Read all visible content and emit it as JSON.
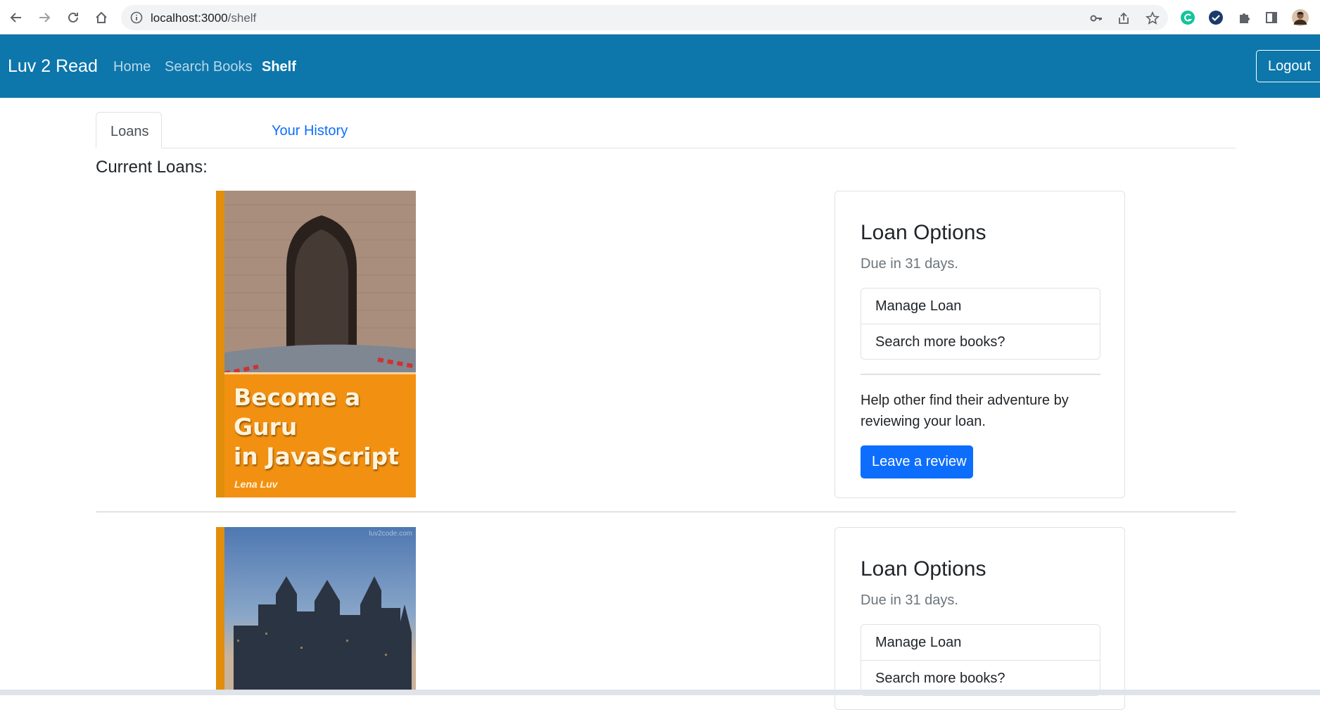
{
  "browser": {
    "url_host": "localhost:3000",
    "url_path": "/shelf",
    "icons": [
      "back-arrow-icon",
      "forward-arrow-icon",
      "reload-icon",
      "home-icon",
      "info-icon",
      "key-icon",
      "share-icon",
      "star-icon",
      "grammarly-icon",
      "check-extension-icon",
      "puzzle-icon",
      "sidepanel-icon",
      "profile-avatar"
    ]
  },
  "navbar": {
    "brand": "Luv 2 Read",
    "links": [
      {
        "label": "Home",
        "active": false
      },
      {
        "label": "Search Books",
        "active": false
      },
      {
        "label": "Shelf",
        "active": true
      }
    ],
    "logout": "Logout",
    "color": "#0d76ab"
  },
  "tabs": [
    {
      "label": "Loans",
      "active": true
    },
    {
      "label": "Your History",
      "active": false
    }
  ],
  "section_title": "Current Loans:",
  "loans": [
    {
      "cover": {
        "title_line1": "Become a Guru",
        "title_line2": "in JavaScript",
        "author": "Lena Luv",
        "color": "#f29111"
      },
      "options": {
        "title": "Loan Options",
        "due": "Due in 31 days.",
        "actions": [
          "Manage Loan",
          "Search more books?"
        ],
        "help": "Help other find their adventure by reviewing your loan.",
        "review_button": "Leave a review"
      }
    },
    {
      "cover": {
        "watermark": "luv2code.com",
        "color": "#f29111"
      },
      "options": {
        "title": "Loan Options",
        "due": "Due in 31 days.",
        "actions": [
          "Manage Loan",
          "Search more books?"
        ]
      }
    }
  ],
  "accent": "#0d6efd"
}
